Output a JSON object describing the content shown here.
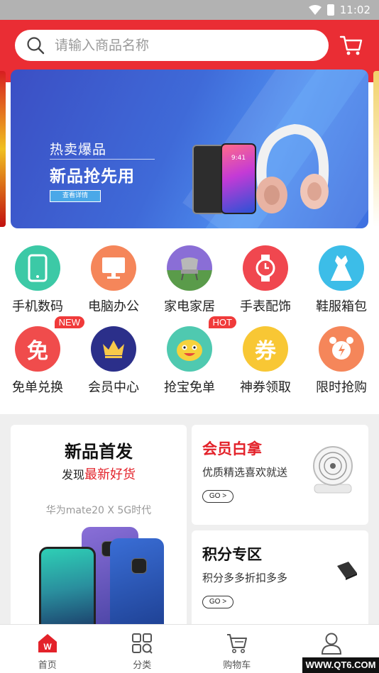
{
  "status_bar": {
    "time": "11:02"
  },
  "search": {
    "placeholder": "请输入商品名称"
  },
  "banner": {
    "subtitle": "热卖爆品",
    "title": "新品抢先用",
    "button": "查看详情",
    "phone_time": "9:41"
  },
  "categories": [
    {
      "label": "手机数码",
      "icon": "phone-icon",
      "color": "#3cc9a6"
    },
    {
      "label": "电脑办公",
      "icon": "monitor-icon",
      "color": "#f5865a"
    },
    {
      "label": "家电家居",
      "icon": "chair-icon",
      "color": "#8a6ed6"
    },
    {
      "label": "手表配饰",
      "icon": "watch-icon",
      "color": "#f0474f"
    },
    {
      "label": "鞋服箱包",
      "icon": "dress-icon",
      "color": "#3cbde8"
    },
    {
      "label": "免单兑换",
      "icon": "free-icon",
      "color": "#f04c4c",
      "badge": "NEW"
    },
    {
      "label": "会员中心",
      "icon": "crown-icon",
      "color": "#2b2f8a"
    },
    {
      "label": "抢宝免单",
      "icon": "mascot-icon",
      "color": "#4fc9b0",
      "badge": "HOT"
    },
    {
      "label": "神券领取",
      "icon": "coupon-icon",
      "color": "#f8c734"
    },
    {
      "label": "限时抢购",
      "icon": "alarm-icon",
      "color": "#f5865a"
    }
  ],
  "promo_big": {
    "title": "新品首发",
    "sub_prefix": "发现",
    "sub_highlight": "最新好货",
    "product": "华为mate20 X    5G时代"
  },
  "promo_vip": {
    "title": "会员白拿",
    "desc": "优质精选喜欢就送",
    "go": "GO >",
    "title_color": "#e3222a"
  },
  "promo_points": {
    "title": "积分专区",
    "desc": "积分多多折扣多多",
    "go": "GO >"
  },
  "bottom_nav": [
    {
      "label": "首页",
      "icon": "home-icon",
      "active": true,
      "badge_text": "W"
    },
    {
      "label": "分类",
      "icon": "category-icon"
    },
    {
      "label": "购物车",
      "icon": "cart-icon"
    },
    {
      "label": "",
      "icon": "user-icon"
    }
  ],
  "watermark": "WWW.QT6.COM"
}
